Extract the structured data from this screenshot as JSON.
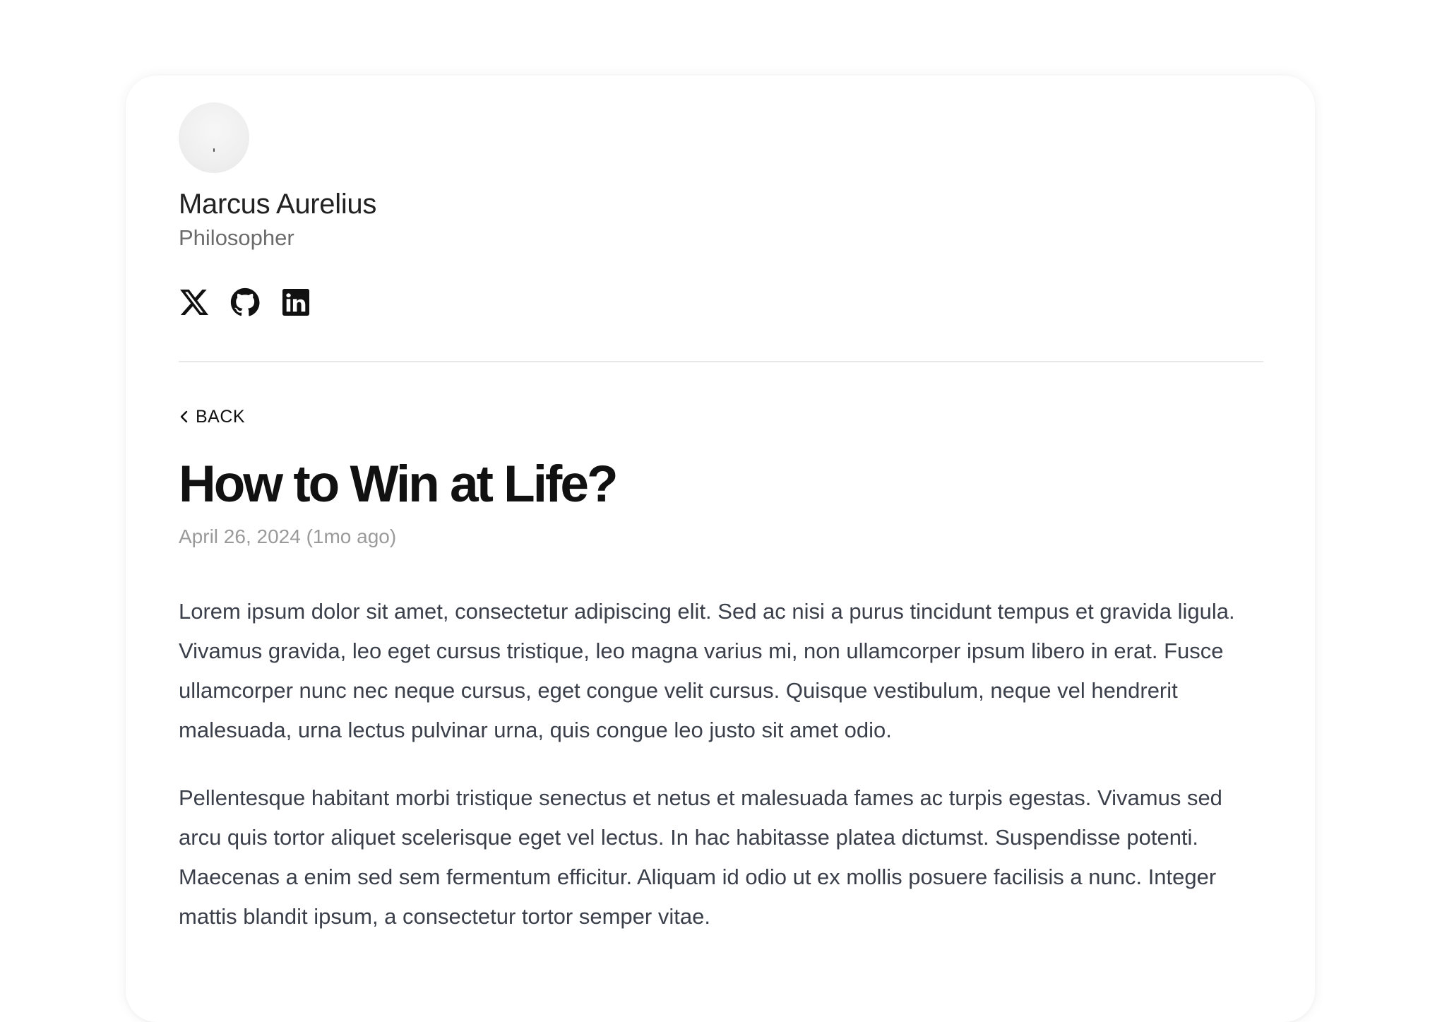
{
  "profile": {
    "name": "Marcus Aurelius",
    "role": "Philosopher",
    "avatar_icon": "avatar-image",
    "socials": [
      {
        "name": "x-icon"
      },
      {
        "name": "github-icon"
      },
      {
        "name": "linkedin-icon"
      }
    ]
  },
  "nav": {
    "back_label": "BACK",
    "back_icon": "chevron-left-icon"
  },
  "post": {
    "title": "How to Win at Life?",
    "date": "April 26, 2024 (1mo ago)",
    "paragraphs": [
      "Lorem ipsum dolor sit amet, consectetur adipiscing elit. Sed ac nisi a purus tincidunt tempus et gravida ligula. Vivamus gravida, leo eget cursus tristique, leo magna varius mi, non ullamcorper ipsum libero in erat. Fusce ullamcorper nunc nec neque cursus, eget congue velit cursus. Quisque vestibulum, neque vel hendrerit malesuada, urna lectus pulvinar urna, quis congue leo justo sit amet odio.",
      "Pellentesque habitant morbi tristique senectus et netus et malesuada fames ac turpis egestas. Vivamus sed arcu quis tortor aliquet scelerisque eget vel lectus. In hac habitasse platea dictumst. Suspendisse potenti. Maecenas a enim sed sem fermentum efficitur. Aliquam id odio ut ex mollis posuere facilisis a nunc. Integer mattis blandit ipsum, a consectetur tortor semper vitae."
    ]
  },
  "colors": {
    "text_primary": "#111111",
    "text_secondary": "#6b6b6b",
    "text_muted": "#9a9a9a",
    "body_text": "#3a3f4a",
    "divider": "#e8e8e8"
  }
}
